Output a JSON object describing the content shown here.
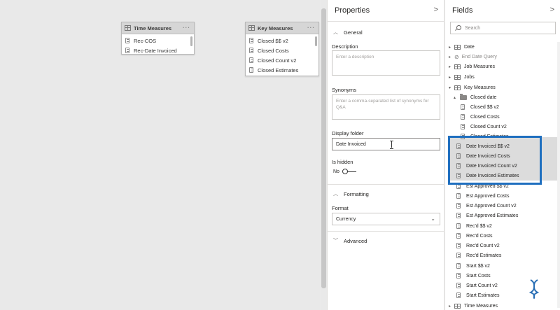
{
  "canvas": {
    "cards": [
      {
        "title": "Time Measures",
        "rows": [
          "Rec-COS",
          "Rec-Date Invoiced"
        ]
      },
      {
        "title": "Key Measures",
        "rows": [
          "Closed $$ v2",
          "Closed Costs",
          "Closed Count v2",
          "Closed Estimates"
        ]
      }
    ],
    "more_glyph": "···"
  },
  "properties": {
    "title": "Properties",
    "collapse_glyph": ">",
    "general_section": "General",
    "description_label": "Description",
    "description_placeholder": "Enter a description",
    "synonyms_label": "Synonyms",
    "synonyms_placeholder": "Enter a comma-separated list of synonyms for Q&A",
    "display_folder_label": "Display folder",
    "display_folder_value": "Date Invoiced",
    "is_hidden_label": "Is hidden",
    "is_hidden_value": "No",
    "formatting_section": "Formatting",
    "format_label": "Format",
    "format_value": "Currency",
    "advanced_section": "Advanced"
  },
  "fields": {
    "title": "Fields",
    "collapse_glyph": ">",
    "search_placeholder": "Search",
    "items": [
      {
        "label": "Date",
        "kind": "table"
      },
      {
        "label": "End Date Query",
        "kind": "hidden-table"
      },
      {
        "label": "Job Measures",
        "kind": "table"
      },
      {
        "label": "Jobs",
        "kind": "table"
      },
      {
        "label": "Key Measures",
        "kind": "table-open"
      },
      {
        "label": "Closed date",
        "kind": "folder"
      },
      {
        "label": "Closed $$ v2",
        "kind": "measure-deep"
      },
      {
        "label": "Closed Costs",
        "kind": "measure-deep"
      },
      {
        "label": "Closed Count v2",
        "kind": "measure-deep"
      },
      {
        "label": "Closed Estimates",
        "kind": "measure-deep"
      },
      {
        "label": "Date Invoiced $$ v2",
        "kind": "measure"
      },
      {
        "label": "Date Invoiced Costs",
        "kind": "measure"
      },
      {
        "label": "Date Invoiced Count v2",
        "kind": "measure"
      },
      {
        "label": "Date Invoiced Estimates",
        "kind": "measure"
      },
      {
        "label": "Est Approved $$ v2",
        "kind": "measure"
      },
      {
        "label": "Est Approved Costs",
        "kind": "measure"
      },
      {
        "label": "Est Approved Count v2",
        "kind": "measure"
      },
      {
        "label": "Est Approved Estimates",
        "kind": "measure"
      },
      {
        "label": "Rec'd $$ v2",
        "kind": "measure"
      },
      {
        "label": "Rec'd Costs",
        "kind": "measure"
      },
      {
        "label": "Rec'd Count v2",
        "kind": "measure"
      },
      {
        "label": "Rec'd Estimates",
        "kind": "measure"
      },
      {
        "label": "Start $$ v2",
        "kind": "measure"
      },
      {
        "label": "Start Costs",
        "kind": "measure"
      },
      {
        "label": "Start Count v2",
        "kind": "measure"
      },
      {
        "label": "Start Estimates",
        "kind": "measure"
      },
      {
        "label": "Time Measures",
        "kind": "table"
      }
    ]
  },
  "colors": {
    "highlight_box": "#1f6fbf",
    "logo": "#2a6fb5"
  }
}
